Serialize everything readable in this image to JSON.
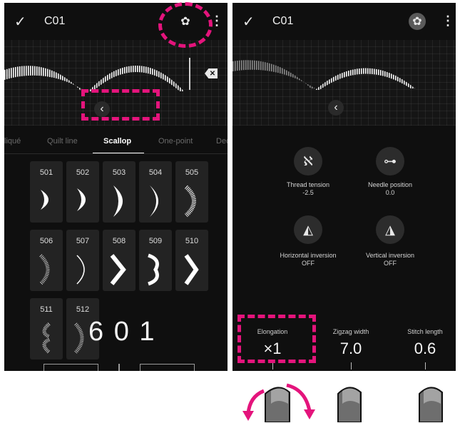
{
  "left_screen": {
    "topbar": {
      "check_icon": "✓",
      "title": "C01",
      "settings_icon": "gear-icon",
      "menu_icon": "⋮"
    },
    "tabs": [
      "liqué",
      "Quilt line",
      "Scallop",
      "One-point",
      "Dec"
    ],
    "active_tab": "Scallop",
    "tiles": [
      {
        "num": "501"
      },
      {
        "num": "502"
      },
      {
        "num": "503"
      },
      {
        "num": "504"
      },
      {
        "num": "505"
      },
      {
        "num": "506"
      },
      {
        "num": "507"
      },
      {
        "num": "508"
      },
      {
        "num": "509"
      },
      {
        "num": "510"
      },
      {
        "num": "511"
      },
      {
        "num": "512"
      }
    ],
    "overlay_number": "6 0 1"
  },
  "right_screen": {
    "topbar": {
      "check_icon": "✓",
      "title": "C01",
      "settings_icon": "gear-icon",
      "menu_icon": "⋮"
    },
    "controls": {
      "thread_tension": {
        "label": "Thread tension",
        "value": "-2.5"
      },
      "needle_position": {
        "label": "Needle position",
        "value": "0.0"
      },
      "horizontal_inversion": {
        "label": "Horizontal inversion",
        "value": "OFF"
      },
      "vertical_inversion": {
        "label": "Vertical inversion",
        "value": "OFF"
      }
    },
    "sliders": [
      {
        "label": "Elongation",
        "value": "×1"
      },
      {
        "label": "Zigzag width",
        "value": "7.0"
      },
      {
        "label": "Stitch length",
        "value": "0.6"
      }
    ]
  },
  "colors": {
    "highlight": "#e4147c",
    "screen_bg": "#0f0f0f"
  }
}
